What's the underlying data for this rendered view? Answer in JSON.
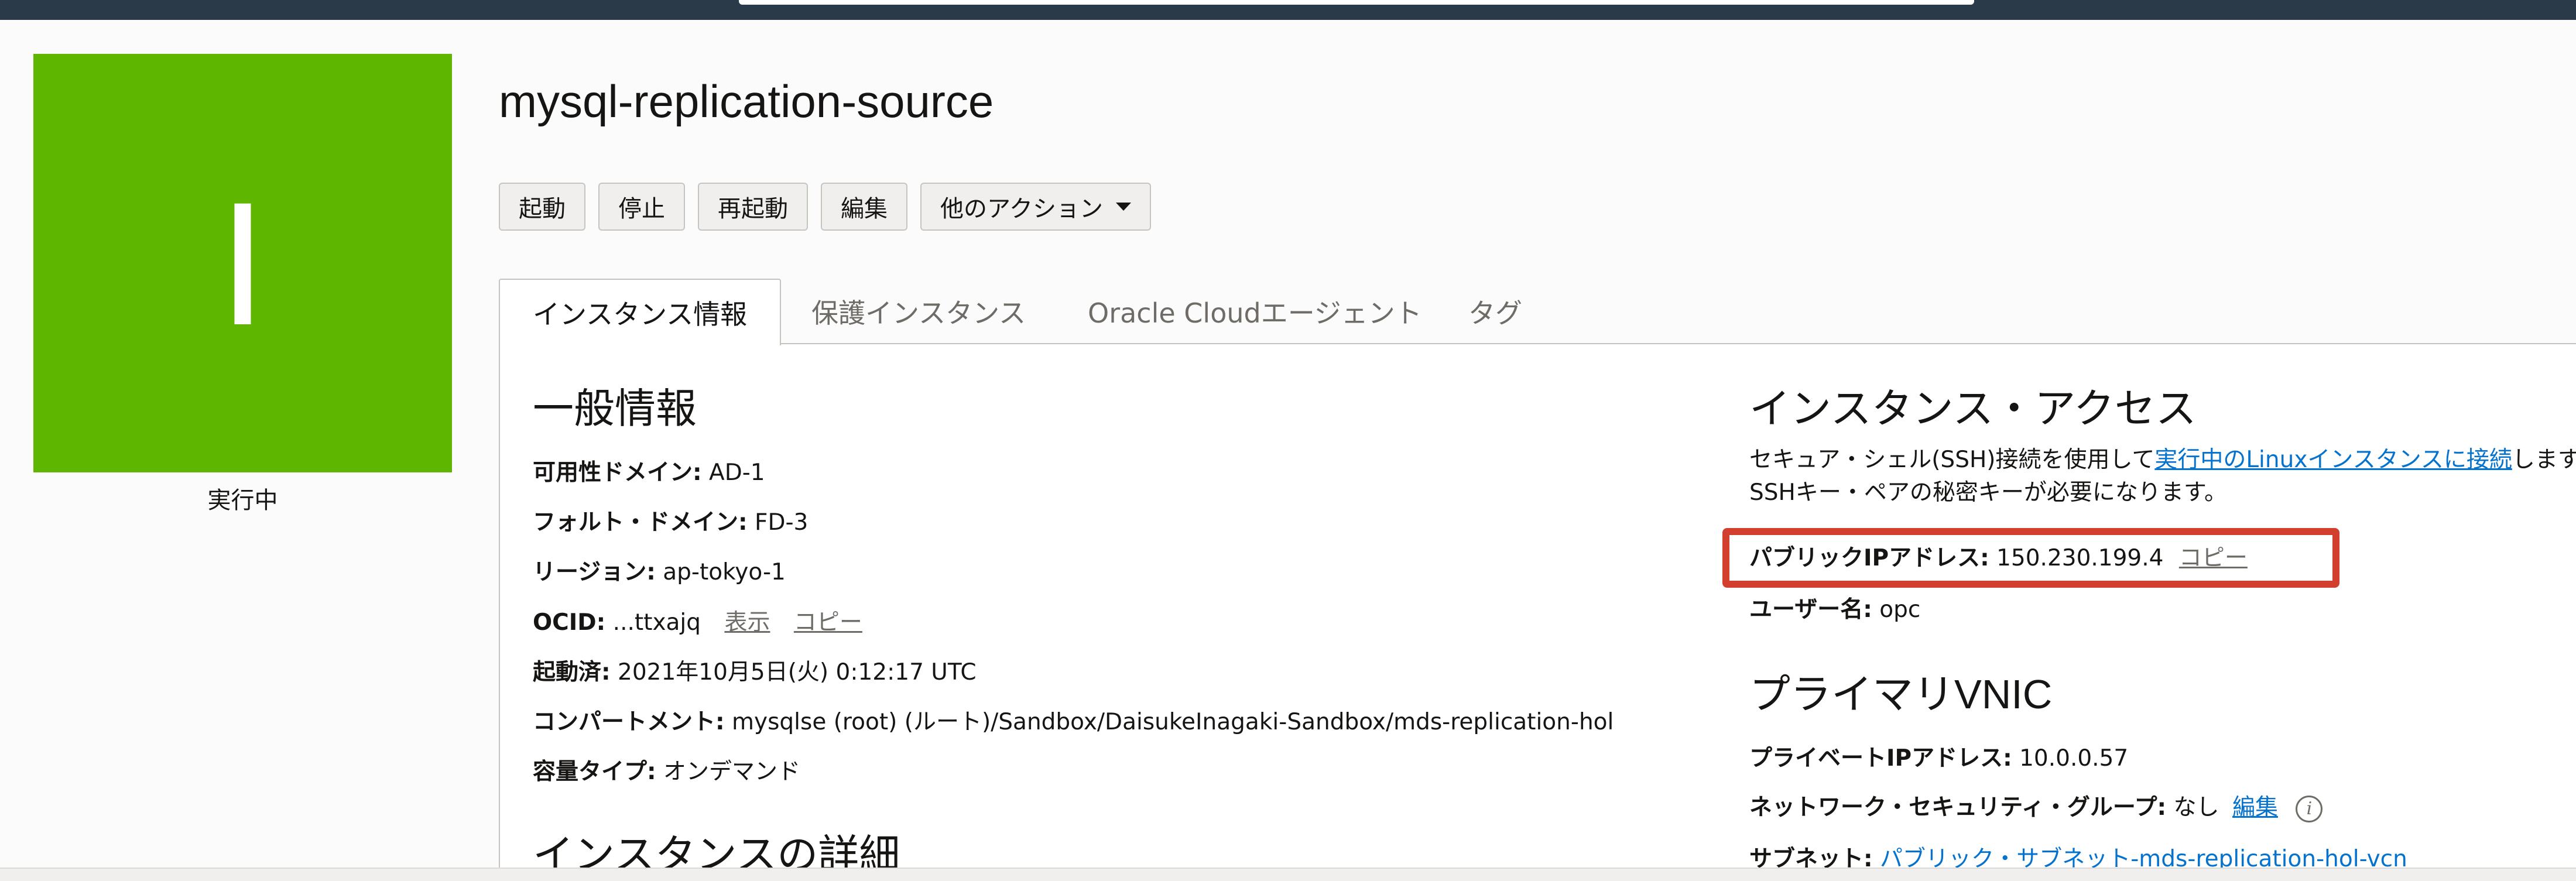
{
  "instance": {
    "icon_letter": "I",
    "status": "実行中",
    "name": "mysql-replication-source",
    "tile_color": "#5fb600"
  },
  "actions": {
    "start": "起動",
    "stop": "停止",
    "reboot": "再起動",
    "edit": "編集",
    "more": "他のアクション"
  },
  "tabs": [
    {
      "label": "インスタンス情報",
      "active": true
    },
    {
      "label": "保護インスタンス",
      "active": false
    },
    {
      "label": "Oracle Cloudエージェント",
      "active": false
    },
    {
      "label": "タグ",
      "active": false
    }
  ],
  "general": {
    "heading": "一般情報",
    "availability_domain_label": "可用性ドメイン:",
    "availability_domain_value": "AD-1",
    "fault_domain_label": "フォルト・ドメイン:",
    "fault_domain_value": "FD-3",
    "region_label": "リージョン:",
    "region_value": "ap-tokyo-1",
    "ocid_label": "OCID:",
    "ocid_value": "...ttxajq",
    "ocid_show": "表示",
    "ocid_copy": "コピー",
    "launched_label": "起動済:",
    "launched_value": "2021年10月5日(火) 0:12:17 UTC",
    "compartment_label": "コンパートメント:",
    "compartment_value": "mysqlse (root) (ルート)/Sandbox/DaisukeInagaki-Sandbox/mds-replication-hol",
    "capacity_label": "容量タイプ:",
    "capacity_value": "オンデマンド"
  },
  "details": {
    "heading": "インスタンスの詳細"
  },
  "access": {
    "heading": "インスタンス・アクセス",
    "desc_prefix": "セキュア・シェル(SSH)接続を使用して",
    "desc_link": "実行中のLinuxインスタンスに接続",
    "desc_suffix": "します",
    "desc_line2": "SSHキー・ペアの秘密キーが必要になります。",
    "public_ip_label": "パブリックIPアドレス:",
    "public_ip_value": "150.230.199.4",
    "public_ip_copy": "コピー",
    "username_label": "ユーザー名:",
    "username_value": "opc",
    "highlight_color": "#d33f2e"
  },
  "vnic": {
    "heading": "プライマリVNIC",
    "private_ip_label": "プライベートIPアドレス:",
    "private_ip_value": "10.0.0.57",
    "nsg_label": "ネットワーク・セキュリティ・グループ:",
    "nsg_value": "なし",
    "nsg_edit": "編集",
    "subnet_label": "サブネット:",
    "subnet_value": "パブリック・サブネット-mds-replication-hol-vcn"
  }
}
